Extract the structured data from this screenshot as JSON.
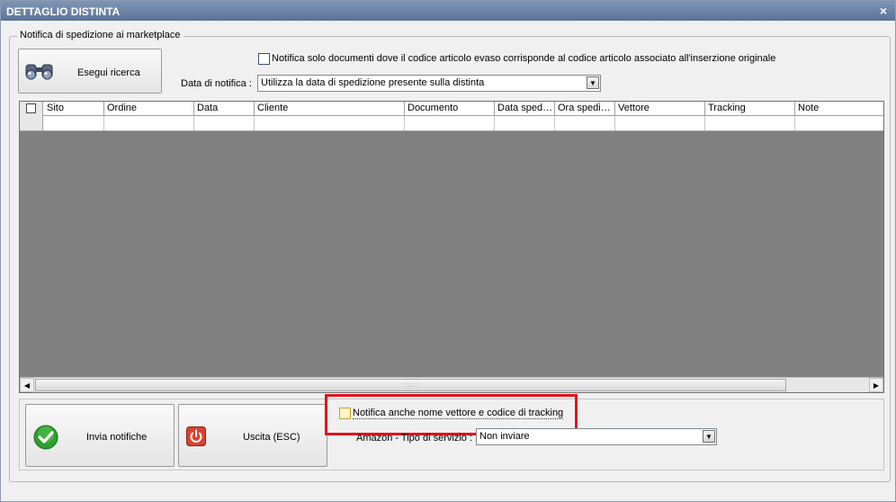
{
  "window": {
    "title": "DETTAGLIO DISTINTA",
    "close_glyph": "×"
  },
  "group": {
    "legend": "Notifica di spedizione ai marketplace"
  },
  "search": {
    "label": "Esegui ricerca",
    "icon": "binoculars-icon"
  },
  "filter": {
    "checkbox_label": "Notifica solo documenti dove il codice articolo evaso corrisponde al codice articolo associato all'inserzione originale",
    "checked": false
  },
  "notification_date": {
    "label": "Data di notifica :",
    "value": "Utilizza la data di spedizione presente sulla distinta"
  },
  "grid": {
    "columns": [
      "Sito",
      "Ordine",
      "Data",
      "Cliente",
      "Documento",
      "Data sped…",
      "Ora spedi…",
      "Vettore",
      "Tracking",
      "Note"
    ],
    "rows": []
  },
  "actions": {
    "send_label": "Invia notifiche",
    "exit_label": "Uscita (ESC)"
  },
  "tracking": {
    "checkbox_label": "Notifica anche nome vettore e codice di tracking",
    "checked": false
  },
  "amazon": {
    "label": "Amazon - Tipo di servizio :",
    "value": "Non inviare"
  },
  "colors": {
    "titlebar": "#5a7396",
    "highlight": "#e0141c",
    "grid_bg": "#808080"
  }
}
